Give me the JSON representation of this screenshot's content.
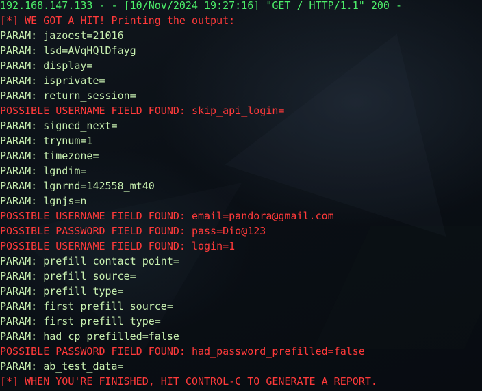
{
  "terminal": {
    "colors": {
      "background": "#0b1118",
      "param": "#c8f0b0",
      "request": "#4df06a",
      "alert": "#ff3a3a"
    },
    "lines": [
      {
        "text": "192.168.147.133 - - [10/Nov/2024 19:27:16] \"GET / HTTP/1.1\" 200 -",
        "kind": "request"
      },
      {
        "text": "[*] WE GOT A HIT! Printing the output:",
        "kind": "alert"
      },
      {
        "text": "PARAM: jazoest=21016",
        "kind": "param"
      },
      {
        "text": "PARAM: lsd=AVqHQlDfayg",
        "kind": "param"
      },
      {
        "text": "PARAM: display=",
        "kind": "param"
      },
      {
        "text": "PARAM: isprivate=",
        "kind": "param"
      },
      {
        "text": "PARAM: return_session=",
        "kind": "param"
      },
      {
        "text": "POSSIBLE USERNAME FIELD FOUND: skip_api_login=",
        "kind": "alert"
      },
      {
        "text": "PARAM: signed_next=",
        "kind": "param"
      },
      {
        "text": "PARAM: trynum=1",
        "kind": "param"
      },
      {
        "text": "PARAM: timezone=",
        "kind": "param"
      },
      {
        "text": "PARAM: lgndim=",
        "kind": "param"
      },
      {
        "text": "PARAM: lgnrnd=142558_mt40",
        "kind": "param"
      },
      {
        "text": "PARAM: lgnjs=n",
        "kind": "param"
      },
      {
        "text": "POSSIBLE USERNAME FIELD FOUND: email=pandora@gmail.com",
        "kind": "alert"
      },
      {
        "text": "POSSIBLE PASSWORD FIELD FOUND: pass=Dio@123",
        "kind": "alert"
      },
      {
        "text": "POSSIBLE USERNAME FIELD FOUND: login=1",
        "kind": "alert"
      },
      {
        "text": "PARAM: prefill_contact_point=",
        "kind": "param"
      },
      {
        "text": "PARAM: prefill_source=",
        "kind": "param"
      },
      {
        "text": "PARAM: prefill_type=",
        "kind": "param"
      },
      {
        "text": "PARAM: first_prefill_source=",
        "kind": "param"
      },
      {
        "text": "PARAM: first_prefill_type=",
        "kind": "param"
      },
      {
        "text": "PARAM: had_cp_prefilled=false",
        "kind": "param"
      },
      {
        "text": "POSSIBLE PASSWORD FIELD FOUND: had_password_prefilled=false",
        "kind": "alert"
      },
      {
        "text": "PARAM: ab_test_data=",
        "kind": "param"
      },
      {
        "text": "[*] WHEN YOU'RE FINISHED, HIT CONTROL-C TO GENERATE A REPORT.",
        "kind": "alert"
      }
    ]
  }
}
